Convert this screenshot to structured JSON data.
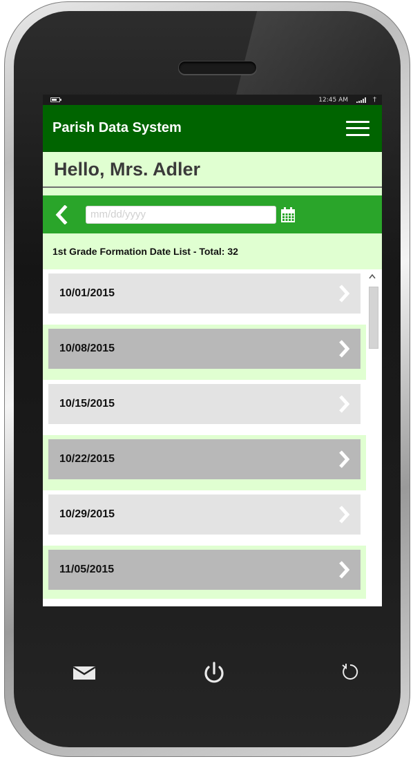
{
  "statusbar": {
    "time": "12:45 AM"
  },
  "app": {
    "title": "Parish Data System"
  },
  "greeting": "Hello, Mrs. Adler",
  "date_filter": {
    "placeholder": "mm/dd/yyyy",
    "value": ""
  },
  "list": {
    "header": "1st Grade Formation Date List - Total: 32",
    "items": [
      {
        "date": "10/01/2015"
      },
      {
        "date": "10/08/2015"
      },
      {
        "date": "10/15/2015"
      },
      {
        "date": "10/22/2015"
      },
      {
        "date": "10/29/2015"
      },
      {
        "date": "11/05/2015"
      }
    ]
  },
  "colors": {
    "appbar": "#006400",
    "datebar": "#2aa52a",
    "light_green": "#e0ffd1",
    "item_light": "#e3e3e3",
    "item_dark": "#b8b8b8"
  },
  "icons": {
    "menu": "hamburger-icon",
    "back": "chevron-left-icon",
    "calendar": "calendar-icon",
    "row": "chevron-right-icon",
    "hardware": [
      "mail-icon",
      "power-icon",
      "refresh-icon"
    ]
  }
}
